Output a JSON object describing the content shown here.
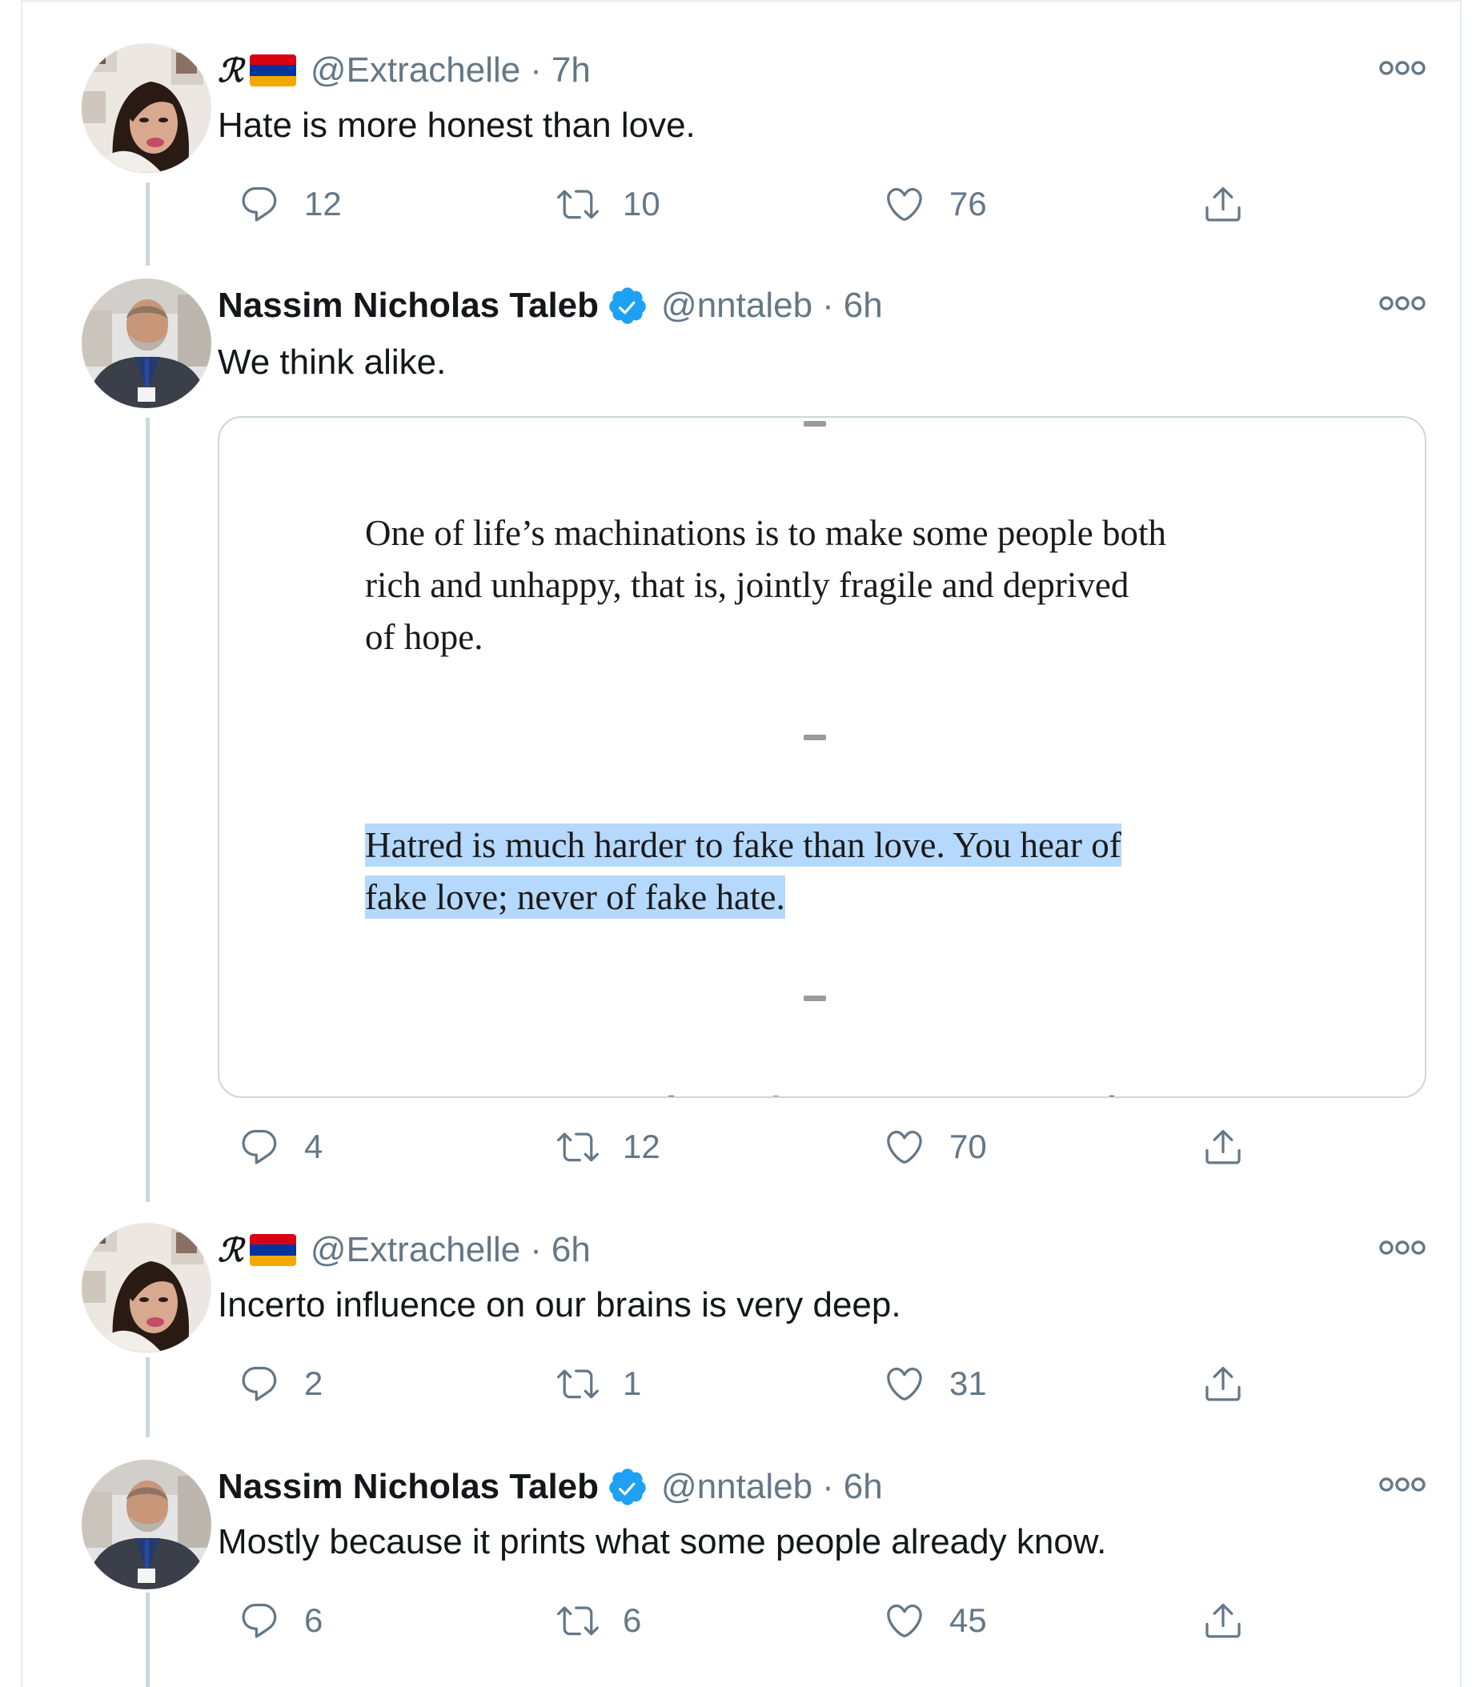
{
  "thread": [
    {
      "user": {
        "display_name": "ℛ",
        "flag": "armenia-flag",
        "handle": "@Extrachelle",
        "verified": false
      },
      "separator": "·",
      "time": "7h",
      "text": "Hate is more honest than love.",
      "stats": {
        "replies": "12",
        "retweets": "10",
        "likes": "76"
      }
    },
    {
      "user": {
        "display_name": "Nassim Nicholas Taleb",
        "handle": "@nntaleb",
        "verified": true
      },
      "separator": "·",
      "time": "6h",
      "text": "We think alike.",
      "media": {
        "paragraph_1": [
          "One of life’s machinations is to make some people both",
          "rich and unhappy, that is, jointly fragile and deprived",
          "of hope."
        ],
        "paragraph_2_highlighted": [
          "Hatred is much harder to fake than love. You hear of",
          "fake love; never of fake hate."
        ],
        "cut_off_line": "Do not trust a man who needs an income—except if it is"
      },
      "stats": {
        "replies": "4",
        "retweets": "12",
        "likes": "70"
      }
    },
    {
      "user": {
        "display_name": "ℛ",
        "flag": "armenia-flag",
        "handle": "@Extrachelle",
        "verified": false
      },
      "separator": "·",
      "time": "6h",
      "text": "Incerto influence on our brains is very deep.",
      "stats": {
        "replies": "2",
        "retweets": "1",
        "likes": "31"
      }
    },
    {
      "user": {
        "display_name": "Nassim Nicholas Taleb",
        "handle": "@nntaleb",
        "verified": true
      },
      "separator": "·",
      "time": "6h",
      "text": "Mostly because it prints what some people already know.",
      "stats": {
        "replies": "6",
        "retweets": "6",
        "likes": "45"
      }
    }
  ],
  "colors": {
    "text_primary": "#14171a",
    "text_secondary": "#657786",
    "verified_blue": "#1da1f2",
    "thread_line": "#ccd6dd",
    "highlight": "#b5d8fd",
    "flag_red": "#d90012",
    "flag_blue": "#0033a0",
    "flag_orange": "#f2a800"
  }
}
